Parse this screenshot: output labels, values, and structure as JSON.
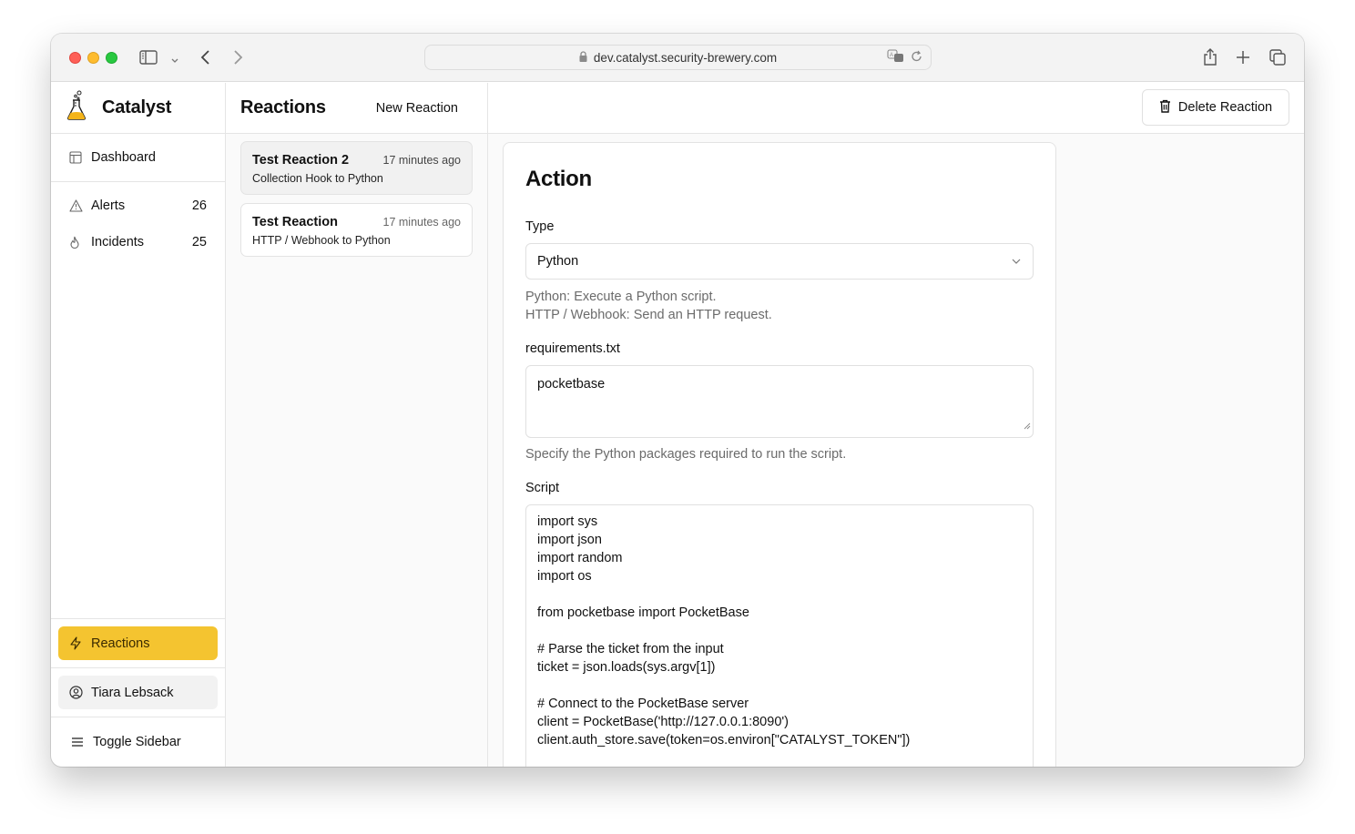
{
  "browser": {
    "url": "dev.catalyst.security-brewery.com"
  },
  "brand": {
    "name": "Catalyst"
  },
  "sidebar": {
    "items": [
      {
        "label": "Dashboard",
        "icon": "dashboard-icon"
      },
      {
        "label": "Alerts",
        "count": "26",
        "icon": "alert-triangle-icon"
      },
      {
        "label": "Incidents",
        "count": "25",
        "icon": "flame-icon"
      }
    ],
    "active": {
      "label": "Reactions",
      "icon": "zap-icon"
    },
    "user": {
      "label": "Tiara Lebsack",
      "icon": "user-circle-icon"
    },
    "toggle": {
      "label": "Toggle Sidebar",
      "icon": "menu-icon"
    }
  },
  "reactions_list": {
    "title": "Reactions",
    "new_label": "New Reaction",
    "items": [
      {
        "title": "Test Reaction 2",
        "time": "17 minutes ago",
        "subtitle": "Collection Hook to Python",
        "selected": true
      },
      {
        "title": "Test Reaction",
        "time": "17 minutes ago",
        "subtitle": "HTTP / Webhook to Python",
        "selected": false
      }
    ]
  },
  "header": {
    "delete_label": "Delete Reaction"
  },
  "action": {
    "title": "Action",
    "type_label": "Type",
    "type_value": "Python",
    "type_help": [
      "Python: Execute a Python script.",
      "HTTP / Webhook: Send an HTTP request."
    ],
    "requirements_label": "requirements.txt",
    "requirements_value": "pocketbase",
    "requirements_help": "Specify the Python packages required to run the script.",
    "script_label": "Script",
    "script_value": "import sys\nimport json\nimport random\nimport os\n\nfrom pocketbase import PocketBase\n\n# Parse the ticket from the input\nticket = json.loads(sys.argv[1])\n\n# Connect to the PocketBase server\nclient = PocketBase('http://127.0.0.1:8090')\nclient.auth_store.save(token=os.environ[\"CATALYST_TOKEN\"])"
  },
  "colors": {
    "accent": "#f4c430",
    "selected_card": "#f1f1f1"
  }
}
